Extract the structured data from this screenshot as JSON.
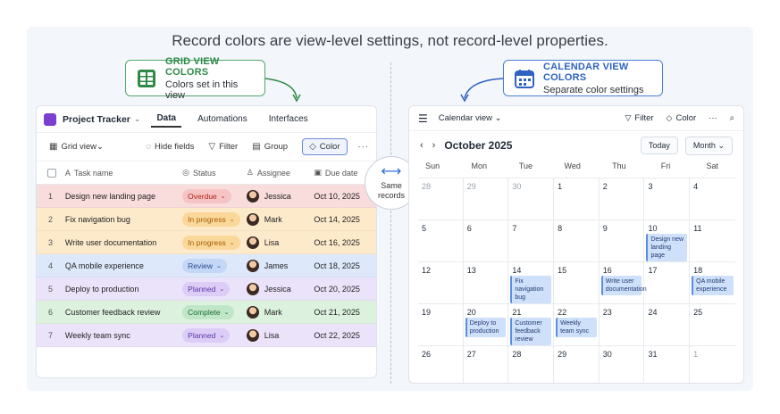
{
  "headline": "Record colors are view-level settings, not record-level properties.",
  "callouts": {
    "grid": {
      "title": "GRID VIEW COLORS",
      "subtitle": "Colors set in this view"
    },
    "calendar": {
      "title": "CALENDAR VIEW COLORS",
      "subtitle": "Separate color settings"
    }
  },
  "grid": {
    "app_title": "Project Tracker",
    "nav": [
      "Data",
      "Automations",
      "Interfaces"
    ],
    "toolbar": {
      "view": "Grid view",
      "hide": "Hide fields",
      "filter": "Filter",
      "group": "Group",
      "color": "Color",
      "more": "···"
    },
    "columns": [
      "Task name",
      "Status",
      "Assignee",
      "Due date"
    ],
    "rows": [
      {
        "num": "1",
        "task": "Design new landing page",
        "status": "Overdue",
        "assignee": "Jessica",
        "due": "Oct 10, 2025",
        "row_color": "#f9dcdc",
        "pill_bg": "#f6c4c4",
        "pill_fg": "#b42318"
      },
      {
        "num": "2",
        "task": "Fix navigation bug",
        "status": "In progress",
        "assignee": "Mark",
        "due": "Oct 14, 2025",
        "row_color": "#fdeacb",
        "pill_bg": "#fbd79a",
        "pill_fg": "#a15c00"
      },
      {
        "num": "3",
        "task": "Write user documentation",
        "status": "In progress",
        "assignee": "Lisa",
        "due": "Oct 16, 2025",
        "row_color": "#fdeacb",
        "pill_bg": "#fbd79a",
        "pill_fg": "#a15c00"
      },
      {
        "num": "4",
        "task": "QA mobile experience",
        "status": "Review",
        "assignee": "James",
        "due": "Oct 18, 2025",
        "row_color": "#dde8fb",
        "pill_bg": "#c4d7f7",
        "pill_fg": "#2a4d8f"
      },
      {
        "num": "5",
        "task": "Deploy to production",
        "status": "Planned",
        "assignee": "Jessica",
        "due": "Oct 20, 2025",
        "row_color": "#ebe3fa",
        "pill_bg": "#dccdf6",
        "pill_fg": "#5b34a8"
      },
      {
        "num": "6",
        "task": "Customer feedback review",
        "status": "Complete",
        "assignee": "Mark",
        "due": "Oct 21, 2025",
        "row_color": "#dcf2df",
        "pill_bg": "#bfe6c6",
        "pill_fg": "#1f6b33"
      },
      {
        "num": "7",
        "task": "Weekly team sync",
        "status": "Planned",
        "assignee": "Lisa",
        "due": "Oct 22, 2025",
        "row_color": "#ebe3fa",
        "pill_bg": "#dccdf6",
        "pill_fg": "#5b34a8"
      }
    ]
  },
  "same_records": {
    "line1": "Same",
    "line2": "records"
  },
  "calendar": {
    "view": "Calendar view",
    "filter": "Filter",
    "color": "Color",
    "more": "···",
    "month": "October 2025",
    "today": "Today",
    "mode": "Month",
    "dow": [
      "Sun",
      "Mon",
      "Tue",
      "Wed",
      "Thu",
      "Fri",
      "Sat"
    ],
    "weeks": [
      [
        {
          "d": "28",
          "dim": true
        },
        {
          "d": "29",
          "dim": true
        },
        {
          "d": "30",
          "dim": true
        },
        {
          "d": "1"
        },
        {
          "d": "2"
        },
        {
          "d": "3"
        },
        {
          "d": "4"
        }
      ],
      [
        {
          "d": "5"
        },
        {
          "d": "6"
        },
        {
          "d": "7"
        },
        {
          "d": "8"
        },
        {
          "d": "9"
        },
        {
          "d": "10",
          "ev": "Design new landing page"
        },
        {
          "d": "11"
        }
      ],
      [
        {
          "d": "12"
        },
        {
          "d": "13"
        },
        {
          "d": "14",
          "ev": "Fix navigation bug"
        },
        {
          "d": "15"
        },
        {
          "d": "16",
          "ev": "Write user documentation"
        },
        {
          "d": "17"
        },
        {
          "d": "18",
          "ev": "QA mobile experience"
        }
      ],
      [
        {
          "d": "19"
        },
        {
          "d": "20",
          "ev": "Deploy to production"
        },
        {
          "d": "21",
          "ev": "Customer feedback review"
        },
        {
          "d": "22",
          "ev": "Weekly team sync"
        },
        {
          "d": "23"
        },
        {
          "d": "24"
        },
        {
          "d": "25"
        }
      ],
      [
        {
          "d": "26"
        },
        {
          "d": "27"
        },
        {
          "d": "28"
        },
        {
          "d": "29"
        },
        {
          "d": "30"
        },
        {
          "d": "31"
        },
        {
          "d": "1",
          "dim": true
        }
      ]
    ]
  }
}
